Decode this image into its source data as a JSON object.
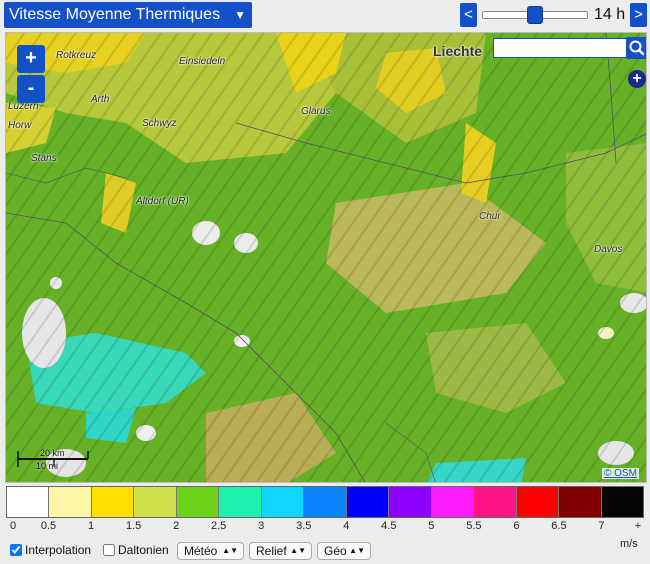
{
  "header": {
    "layer_title": "Vitesse Moyenne Thermiques",
    "prev_label": "<",
    "next_label": ">",
    "hour": "14 h",
    "hour_fraction": 0.5
  },
  "map": {
    "zoom_in": "+",
    "zoom_out": "-",
    "expand": "+",
    "search": {
      "value": "",
      "placeholder": ""
    },
    "places": [
      {
        "label": "Rotkreuz"
      },
      {
        "label": "Einsiedeln"
      },
      {
        "label": "Luzern"
      },
      {
        "label": "Horw"
      },
      {
        "label": "Arth"
      },
      {
        "label": "Schwyz"
      },
      {
        "label": "Glarus"
      },
      {
        "label": "Stans"
      },
      {
        "label": "Altdorf (UR)"
      },
      {
        "label": "Chur"
      },
      {
        "label": "Davos"
      },
      {
        "label": "Liechte"
      }
    ],
    "scale": {
      "km": "20 km",
      "mi": "10 mi"
    },
    "attribution": "© OSM"
  },
  "legend": {
    "colors": [
      "#ffffff",
      "#fff6a6",
      "#ffde00",
      "#cfe04a",
      "#6cd219",
      "#1ef0b0",
      "#10d6ff",
      "#0c84ff",
      "#0000ff",
      "#8d00ff",
      "#ff1eff",
      "#ff1487",
      "#ff0000",
      "#7f0000",
      "#050505"
    ],
    "ticks": [
      "0",
      "0.5",
      "1",
      "1.5",
      "2",
      "2.5",
      "3",
      "3.5",
      "4",
      "4.5",
      "5",
      "5.5",
      "6",
      "6.5",
      "7",
      "+"
    ],
    "unit": "m/s"
  },
  "controls": {
    "interpolation": {
      "label": "Interpolation",
      "checked": true
    },
    "daltonien": {
      "label": "Daltonien",
      "checked": false
    },
    "meteo": "Météo",
    "relief": "Relief",
    "geo": "Géo"
  }
}
